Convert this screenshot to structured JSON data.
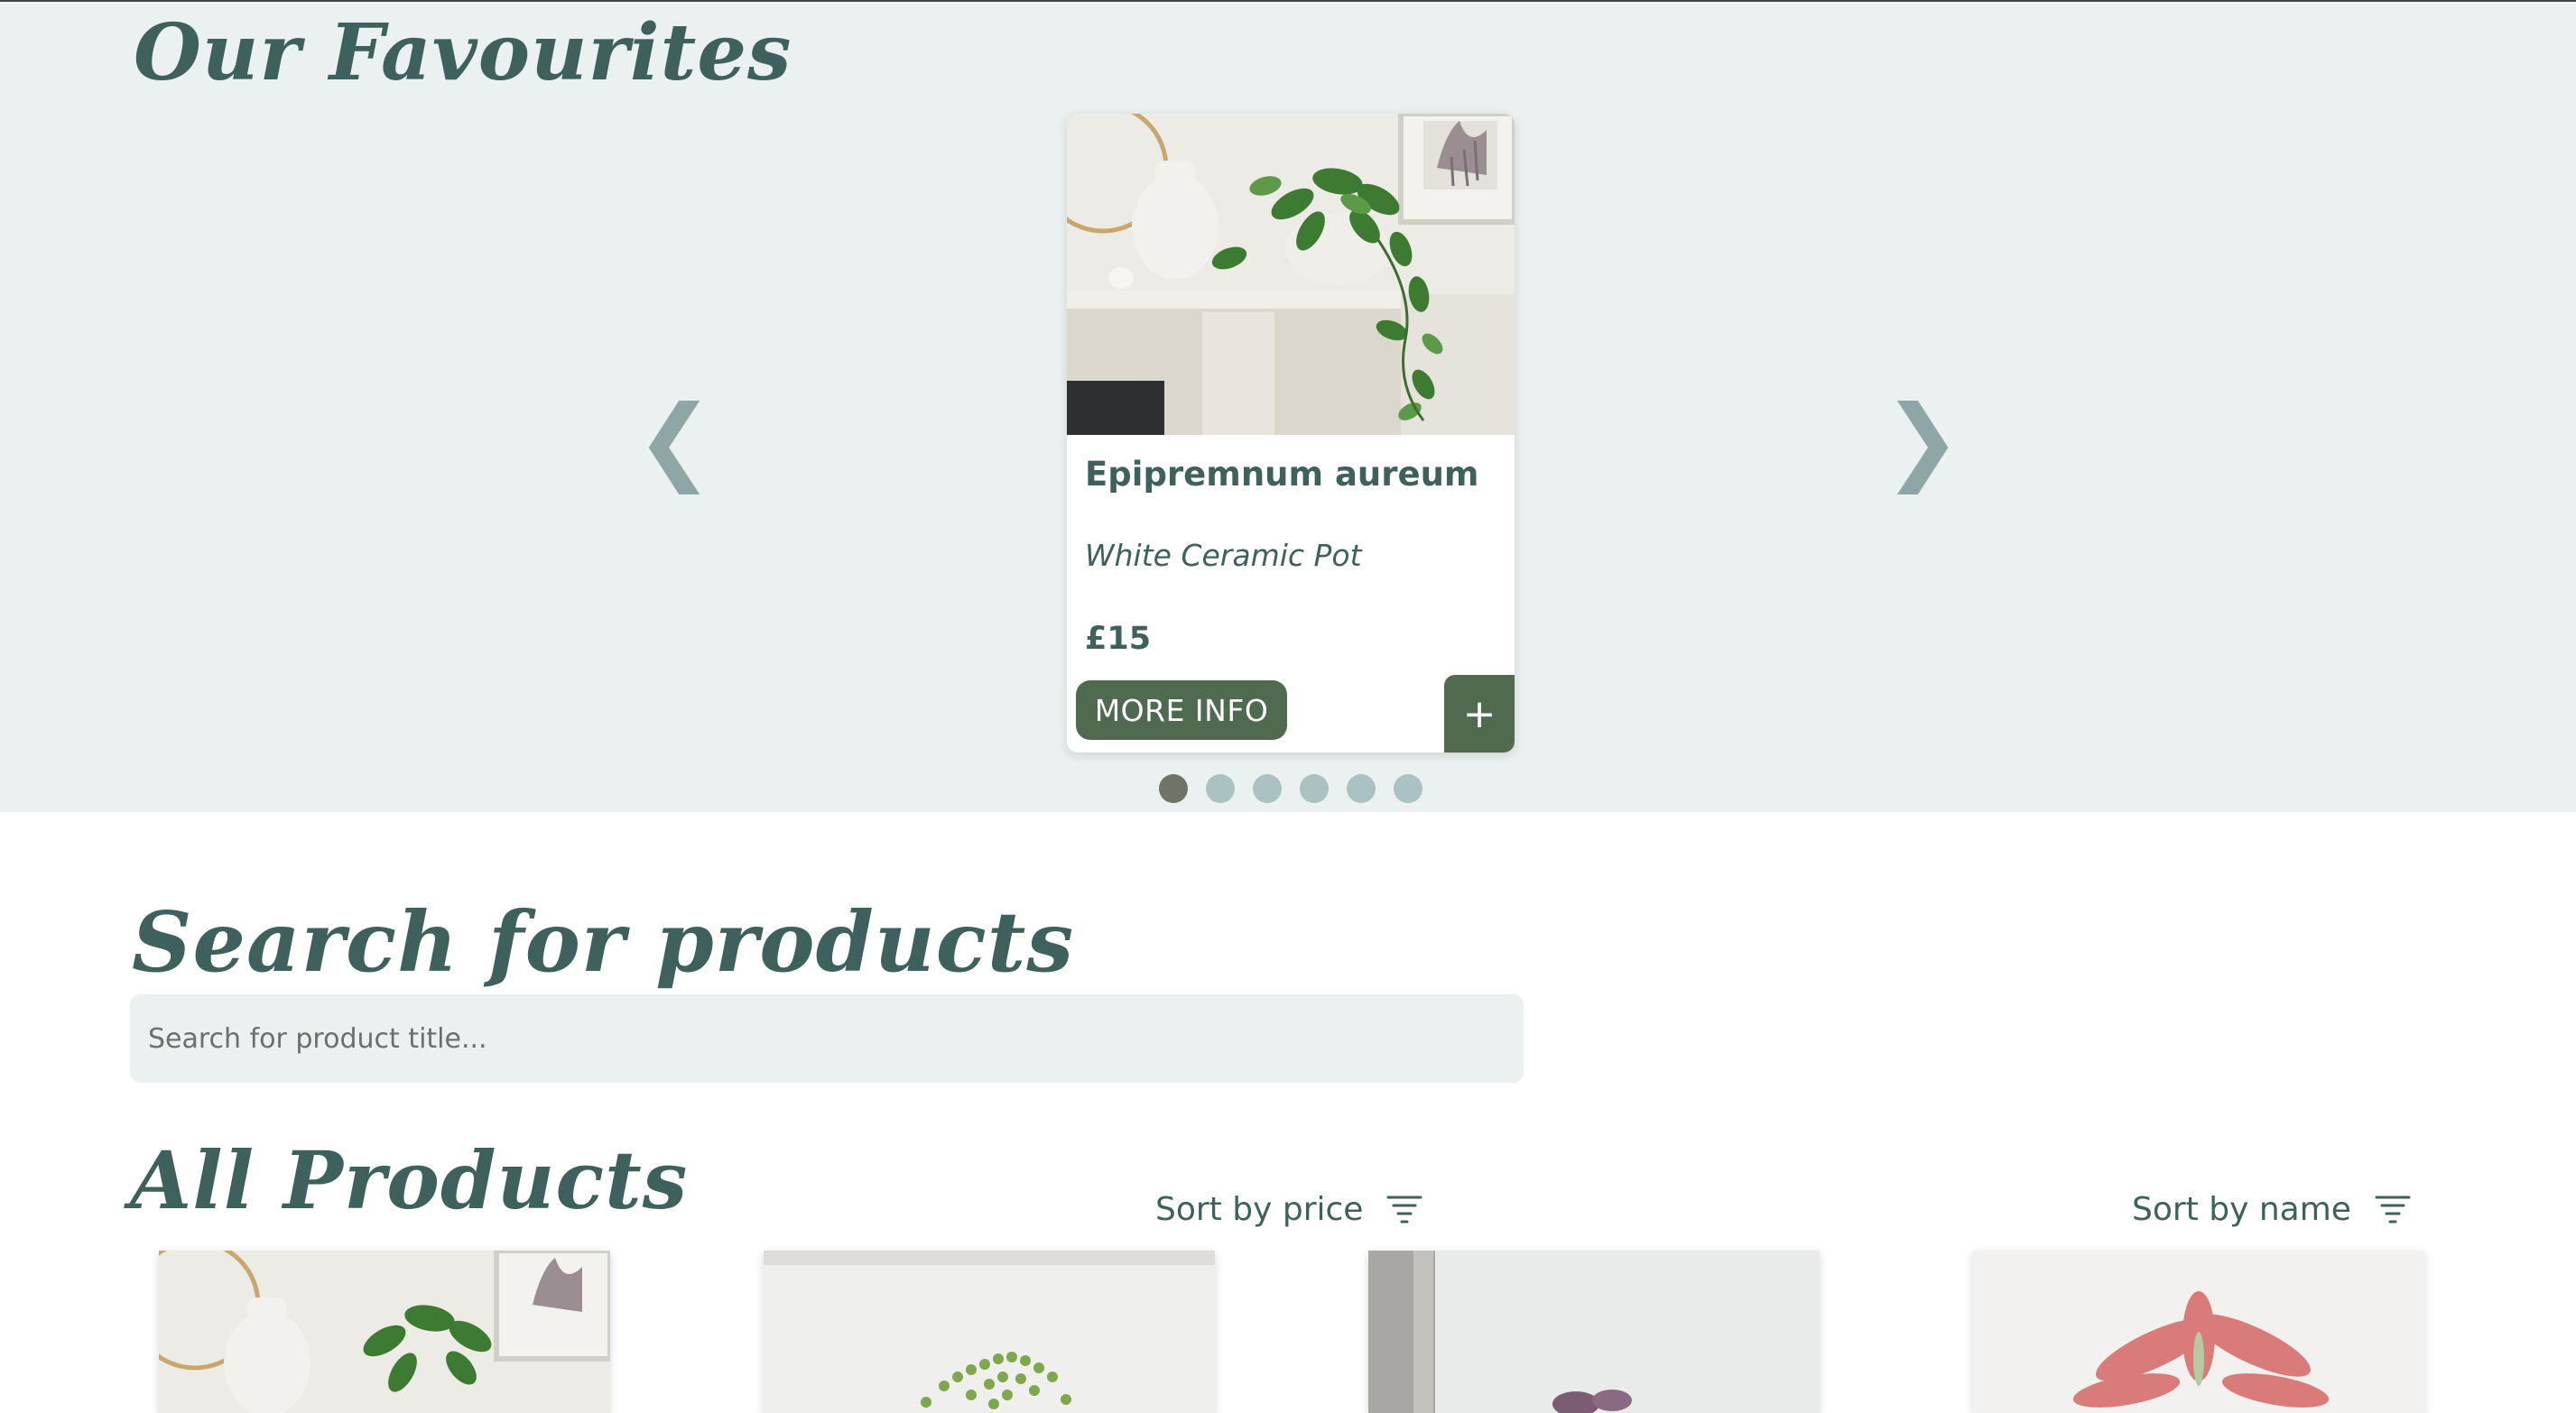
{
  "favourites": {
    "title": "Our Favourites",
    "prev_arrow": "❮",
    "next_arrow": "❯",
    "card": {
      "name": "Epipremnum aureum",
      "pot": "White Ceramic Pot",
      "price": "£15",
      "more_info_label": "MORE INFO",
      "add_label": "+"
    },
    "carousel": {
      "slide_count": 6,
      "active_index": 0
    }
  },
  "search": {
    "title": "Search for products",
    "placeholder": "Search for product title..."
  },
  "products": {
    "title": "All Products",
    "sort_price_label": "Sort by price",
    "sort_name_label": "Sort by name"
  },
  "colors": {
    "brand_green": "#4f6a4e",
    "heading_teal": "#3f615e",
    "band_bg": "#ebf0f0",
    "dot_inactive": "#aac3c2",
    "dot_active": "#6f7466"
  }
}
